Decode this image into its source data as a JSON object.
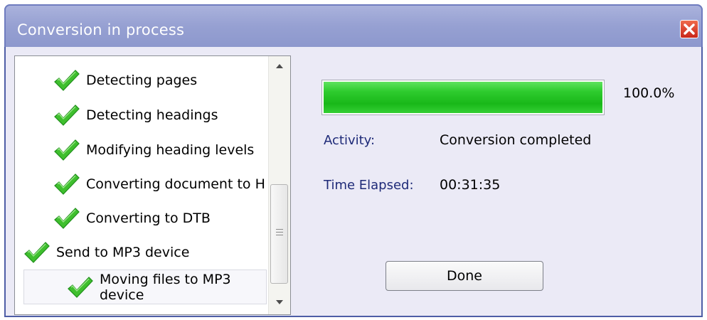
{
  "window": {
    "title": "Conversion in process"
  },
  "tasks": [
    {
      "label": "Detecting pages",
      "status": "completed"
    },
    {
      "label": "Detecting headings",
      "status": "completed"
    },
    {
      "label": "Modifying heading levels",
      "status": "completed"
    },
    {
      "label": "Converting document to H",
      "status": "completed"
    },
    {
      "label": "Converting to DTB",
      "status": "completed"
    },
    {
      "label": "Send to MP3 device",
      "status": "completed"
    },
    {
      "label": "Moving files to MP3 device",
      "status": "completed",
      "selected": true
    }
  ],
  "progress": {
    "fraction": 1.0,
    "percent_text": "100.0%"
  },
  "details": {
    "activity_label": "Activity:",
    "activity_value": "Conversion completed",
    "time_label": "Time Elapsed:",
    "time_value": "00:31:35"
  },
  "buttons": {
    "done_label": "Done"
  },
  "colors": {
    "accent_green": "#19b819",
    "label_blue": "#1e2a78",
    "titlebar": "#96a0d2",
    "close_red": "#c9261a"
  },
  "icons": {
    "task_status": "checkmark-icon",
    "close": "close-icon"
  }
}
